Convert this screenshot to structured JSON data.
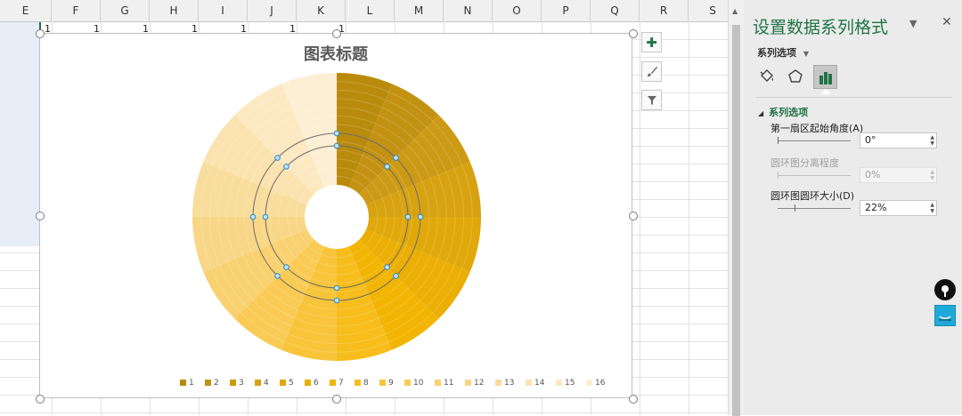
{
  "sheet": {
    "columns": [
      "E",
      "F",
      "G",
      "H",
      "I",
      "J",
      "K",
      "L",
      "M",
      "N",
      "O",
      "P",
      "Q",
      "R",
      "S"
    ],
    "row1_values": [
      "1",
      "1",
      "1",
      "1",
      "1",
      "1",
      "1"
    ]
  },
  "chart": {
    "title": "图表标题",
    "legend": [
      "1",
      "2",
      "3",
      "4",
      "5",
      "6",
      "7",
      "8",
      "9",
      "10",
      "11",
      "12",
      "13",
      "14",
      "15",
      "16"
    ],
    "side_buttons": {
      "add_icon": "plus-icon",
      "style_icon": "brush-icon",
      "filter_icon": "filter-icon"
    }
  },
  "chart_data": {
    "type": "doughnut",
    "title": "图表标题",
    "categories": [
      "1",
      "2",
      "3",
      "4",
      "5",
      "6",
      "7",
      "8",
      "9",
      "10",
      "11",
      "12",
      "13",
      "14",
      "15",
      "16"
    ],
    "series": [
      {
        "values": [
          1,
          1,
          1,
          1,
          1,
          1,
          1,
          1,
          1,
          1,
          1,
          1,
          1,
          1,
          1,
          1
        ]
      }
    ],
    "colors": [
      "#b98b0c",
      "#c39212",
      "#cc9a14",
      "#d6a211",
      "#e0a80a",
      "#eaae05",
      "#f2b503",
      "#f6bd1c",
      "#f8c43a",
      "#f9cb55",
      "#f9d170",
      "#f9d788",
      "#f9dd9c",
      "#fbe3b0",
      "#fce9c2",
      "#fdefd3"
    ],
    "first_slice_angle_deg": 0,
    "hole_size_percent": 22
  },
  "pane": {
    "title": "设置数据系列格式",
    "dropdown_label": "系列选项",
    "section_label": "系列选项",
    "fields": [
      {
        "label": "第一扇区起始角度(A)",
        "value": "0°"
      },
      {
        "label": "圆环图分离程度",
        "value": "0%"
      },
      {
        "label": "圆环图圆环大小(D)",
        "value": "22%"
      }
    ],
    "tabs": [
      "fill-line-icon",
      "effects-icon",
      "series-options-icon"
    ]
  },
  "ui": {
    "accent": "#217346"
  }
}
